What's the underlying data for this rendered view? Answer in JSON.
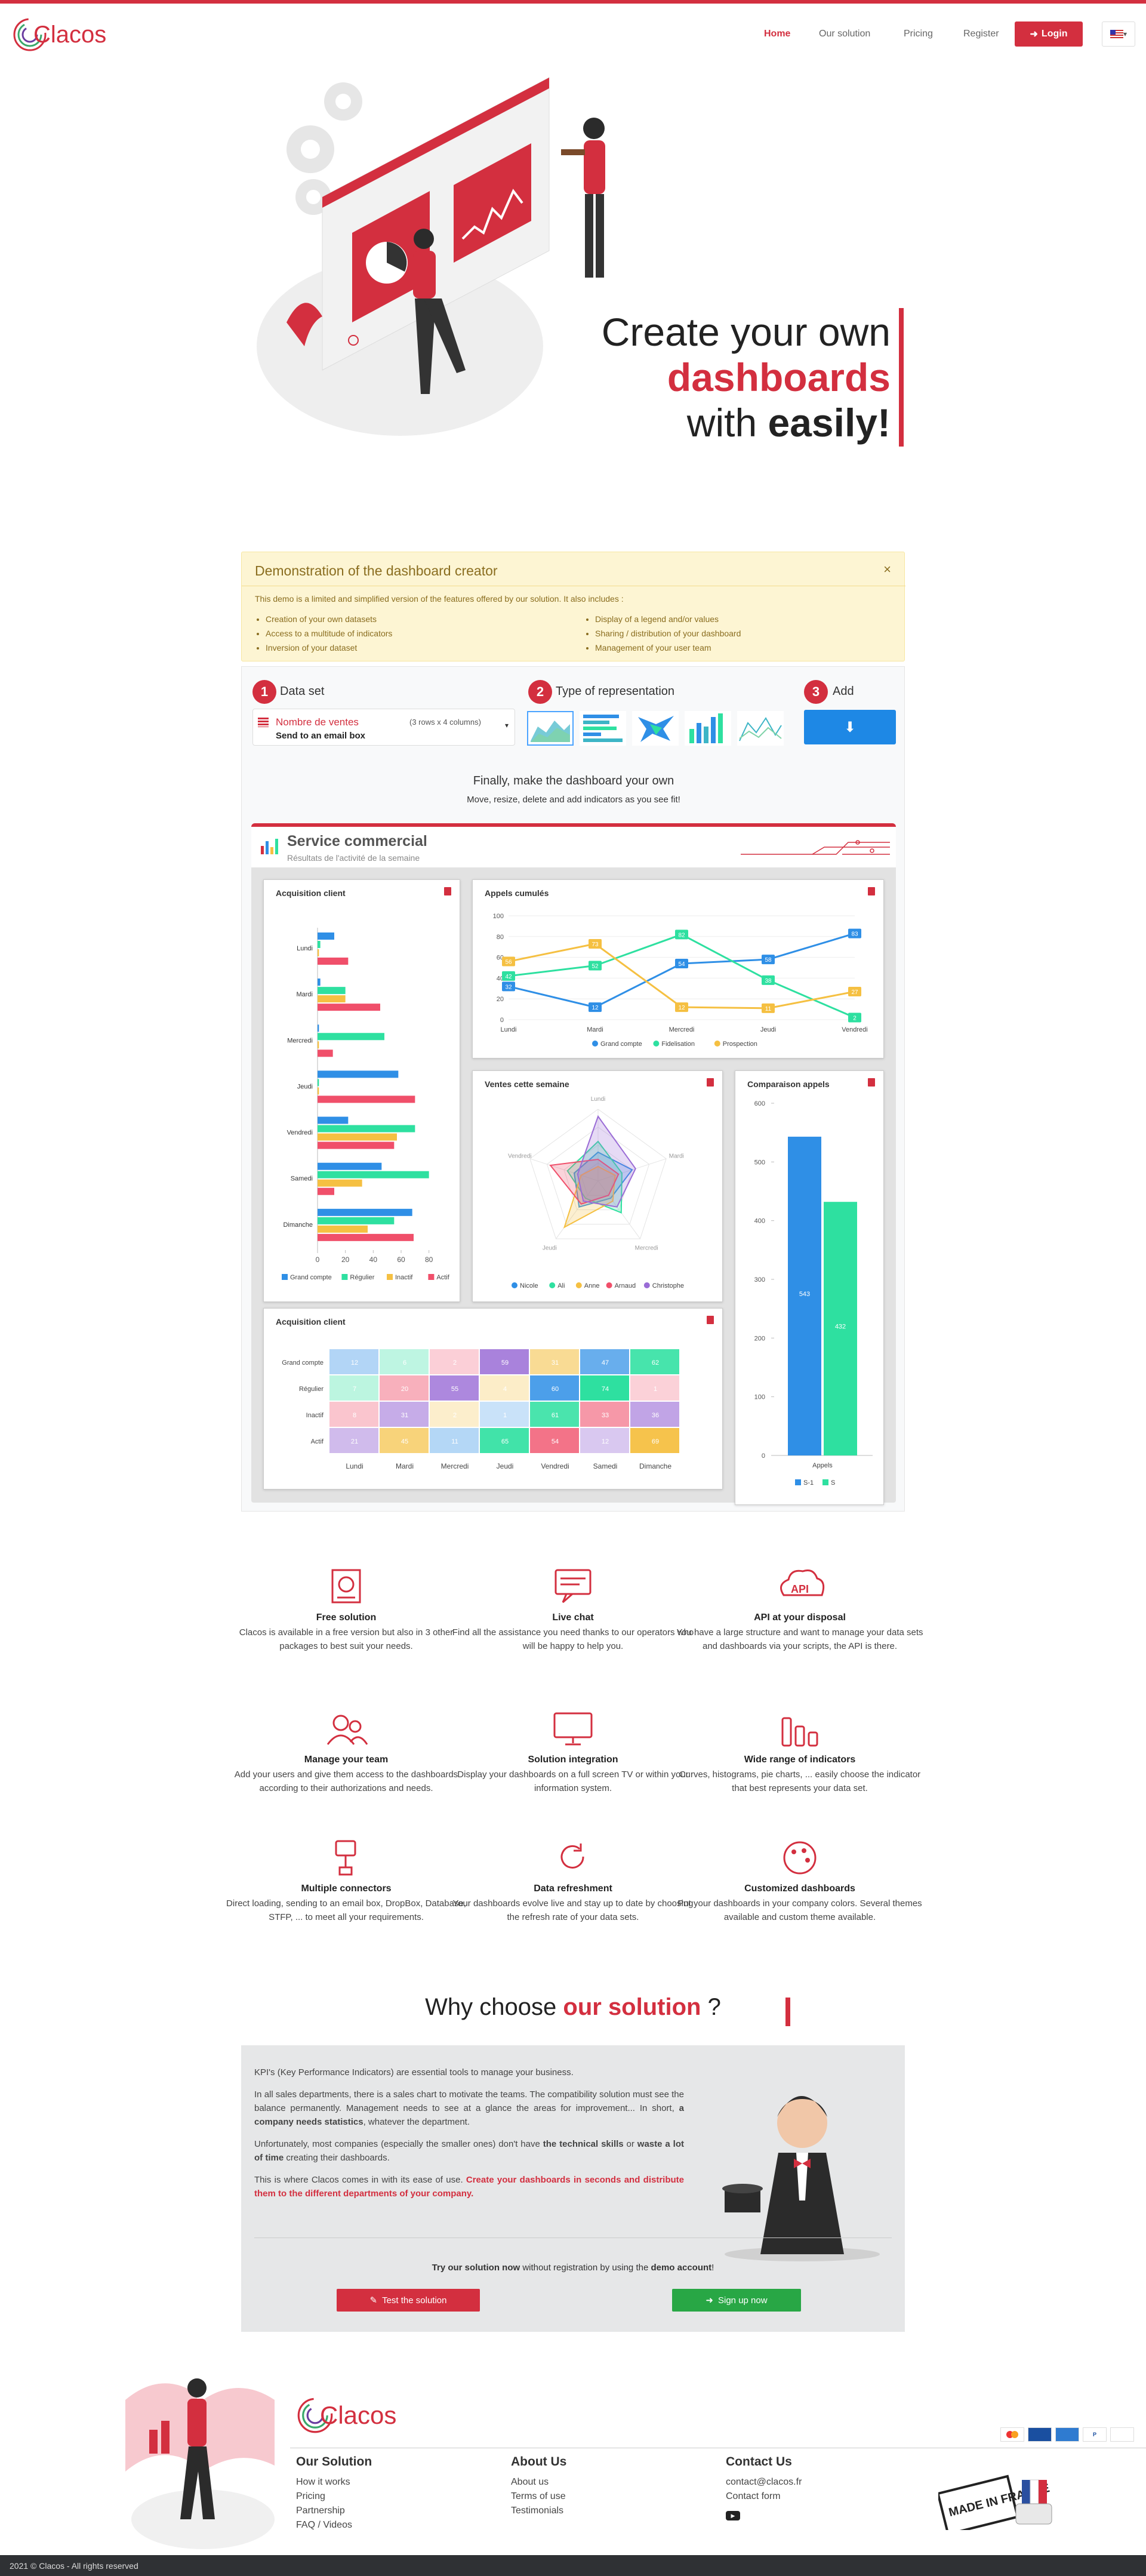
{
  "nav": {
    "logo": "Clacos",
    "home": "Home",
    "solution": "Our solution",
    "pricing": "Pricing",
    "register": "Register",
    "login": "Login"
  },
  "hero": {
    "line1": "Create your own",
    "line2": "dashboards",
    "line3a": "with ",
    "line3b": "easily!"
  },
  "demo_notice": {
    "title": "Demonstration of the dashboard creator",
    "intro": "This demo is a limited and simplified version of the features offered by our solution. It also includes :",
    "left": [
      "Creation of your own datasets",
      "Access to a multitude of indicators",
      "Inversion of your dataset"
    ],
    "right": [
      "Display of a legend and/or values",
      "Sharing / distribution of your dashboard",
      "Management of your user team"
    ],
    "close": "×"
  },
  "steps": {
    "s1": {
      "num": "1",
      "label": "Data set"
    },
    "s2": {
      "num": "2",
      "label": "Type of representation"
    },
    "s3": {
      "num": "3",
      "label": "Add"
    },
    "dataset_name": "Nombre de ventes",
    "dataset_size": "(3 rows x 4 columns)",
    "dataset_action": "Send to an email box"
  },
  "finally": {
    "title": "Finally, make the dashboard your own",
    "sub": "Move, resize, delete and add indicators as you see fit!"
  },
  "dashboard": {
    "title": "Service commercial",
    "subtitle": "Résultats de l'activité de la semaine"
  },
  "colors": {
    "blue": "#2f8fe6",
    "green": "#2ee0a0",
    "yellow": "#f5c042",
    "red": "#f04f6a",
    "purple": "#9a6cd6",
    "brand": "#d32f3f"
  },
  "chart_data": [
    {
      "type": "bar",
      "orientation": "horizontal",
      "title": "Acquisition client",
      "categories": [
        "Lundi",
        "Mardi",
        "Mercredi",
        "Jeudi",
        "Vendredi",
        "Samedi",
        "Dimanche"
      ],
      "series": [
        {
          "name": "Grand compte",
          "values": [
            12,
            2,
            1,
            58,
            22,
            46,
            68
          ]
        },
        {
          "name": "Régulier",
          "values": [
            2,
            20,
            48,
            1,
            70,
            80,
            55
          ]
        },
        {
          "name": "Inactif",
          "values": [
            1,
            20,
            1,
            1,
            57,
            32,
            36
          ]
        },
        {
          "name": "Actif",
          "values": [
            22,
            45,
            11,
            70,
            55,
            12,
            69
          ]
        }
      ],
      "xticks": [
        "0",
        "20",
        "40",
        "60",
        "80"
      ],
      "xlim": [
        0,
        90
      ]
    },
    {
      "type": "line",
      "title": "Appels cumulés",
      "categories": [
        "Lundi",
        "Mardi",
        "Mercredi",
        "Jeudi",
        "Vendredi"
      ],
      "series": [
        {
          "name": "Grand compte",
          "values": [
            32,
            12,
            54,
            58,
            83
          ]
        },
        {
          "name": "Fidelisation",
          "values": [
            42,
            52,
            82,
            38,
            2
          ]
        },
        {
          "name": "Prospection",
          "values": [
            56,
            73,
            12,
            11,
            27
          ]
        }
      ],
      "yticks": [
        "0",
        "20",
        "40",
        "60",
        "80",
        "100"
      ],
      "ylim": [
        0,
        100
      ]
    },
    {
      "type": "radar",
      "title": "Ventes cette semaine",
      "axes": [
        "Lundi",
        "Mardi",
        "Mercredi",
        "Jeudi",
        "Vendredi"
      ],
      "series": [
        {
          "name": "Nicole",
          "values": [
            40,
            50,
            30,
            45,
            35
          ]
        },
        {
          "name": "Ali",
          "values": [
            55,
            35,
            55,
            30,
            45
          ]
        },
        {
          "name": "Anne",
          "values": [
            20,
            25,
            35,
            80,
            25
          ]
        },
        {
          "name": "Arnaud",
          "values": [
            30,
            30,
            25,
            40,
            70
          ]
        },
        {
          "name": "Christophe",
          "values": [
            90,
            55,
            45,
            35,
            30
          ]
        }
      ]
    },
    {
      "type": "bar",
      "title": "Comparaison appels",
      "categories": [
        "Appels"
      ],
      "series": [
        {
          "name": "S-1",
          "values": [
            543
          ]
        },
        {
          "name": "S",
          "values": [
            432
          ]
        }
      ],
      "yticks": [
        "0",
        "100",
        "200",
        "300",
        "400",
        "500",
        "600"
      ],
      "ylim": [
        0,
        600
      ]
    },
    {
      "type": "heatmap",
      "title": "Acquisition client",
      "rows": [
        "Grand compte",
        "Régulier",
        "Inactif",
        "Actif"
      ],
      "cols": [
        "Lundi",
        "Mardi",
        "Mercredi",
        "Jeudi",
        "Vendredi",
        "Samedi",
        "Dimanche"
      ],
      "values": [
        [
          12,
          6,
          2,
          59,
          31,
          47,
          62
        ],
        [
          7,
          20,
          55,
          4,
          60,
          74,
          1
        ],
        [
          8,
          31,
          2,
          1,
          61,
          33,
          36
        ],
        [
          21,
          45,
          11,
          65,
          54,
          12,
          69
        ]
      ]
    }
  ],
  "features": [
    {
      "icon": "free-solution-icon",
      "title": "Free solution",
      "text": "Clacos is available in a free version but also in 3 other packages to best suit your needs."
    },
    {
      "icon": "live-chat-icon",
      "title": "Live chat",
      "text": "Find all the assistance you need thanks to our operators who will be happy to help you."
    },
    {
      "icon": "api-icon",
      "title": "API at your disposal",
      "text": "You have a large structure and want to manage your data sets and dashboards via your scripts, the API is there."
    },
    {
      "icon": "team-icon",
      "title": "Manage your team",
      "text": "Add your users and give them access to the dashboards according to their authorizations and needs."
    },
    {
      "icon": "screen-icon",
      "title": "Solution integration",
      "text": "Display your dashboards on a full screen TV or within your information system."
    },
    {
      "icon": "bars-icon",
      "title": "Wide range of indicators",
      "text": "Curves, histograms, pie charts, ... easily choose the indicator that best represents your data set."
    },
    {
      "icon": "connector-icon",
      "title": "Multiple connectors",
      "text": "Direct loading, sending to an email box, DropBox, Database, STFP, ... to meet all your requirements."
    },
    {
      "icon": "refresh-icon",
      "title": "Data refreshment",
      "text": "Your dashboards evolve live and stay up to date by choosing the refresh rate of your data sets."
    },
    {
      "icon": "palette-icon",
      "title": "Customized dashboards",
      "text": "Put your dashboards in your company colors. Several themes available and custom theme available."
    }
  ],
  "why": {
    "title_a": "Why choose ",
    "title_b": "our solution",
    " title_c": " ?",
    "p1": "KPI's (Key Performance Indicators) are essential tools to manage your business.",
    "p2a": "In all sales departments, there is a sales chart to motivate the teams. The compatibility solution must see the balance permanently. Management needs to see at a glance the areas for improvement... In short, ",
    "p2b": "a company needs statistics",
    ",p2c": ", whatever the department.",
    "p3a": "Unfortunately, most companies (especially the smaller ones) don't have ",
    "p3b": "the technical skills",
    "p3c": " or ",
    "p3d": "waste a lot of time",
    "p3e": " creating their dashboards.",
    "p4a": "This is where Clacos comes in with its ease of use. ",
    "p4b": "Create your dashboards in seconds and distribute them to the different departments of your company.",
    "cta_a": "Try our solution now",
    "cta_b": " without registration by using the ",
    "cta_c": "demo account",
    "cta_d": "!",
    "test": "Test the solution",
    "signup": "Sign up now"
  },
  "footer": {
    "logo": "Clacos",
    "col1": {
      "title": "Our Solution",
      "links": [
        "How it works",
        "Pricing",
        "Partnership",
        "FAQ / Videos"
      ]
    },
    "col2": {
      "title": "About Us",
      "links": [
        "About us",
        "Terms of use",
        "Testimonials"
      ]
    },
    "col3": {
      "title": "Contact Us",
      "links": [
        "contact@clacos.fr",
        "Contact form"
      ]
    },
    "made_in": "MADE IN FRANCE",
    "copyright": "2021 © Clacos - All rights reserved"
  }
}
